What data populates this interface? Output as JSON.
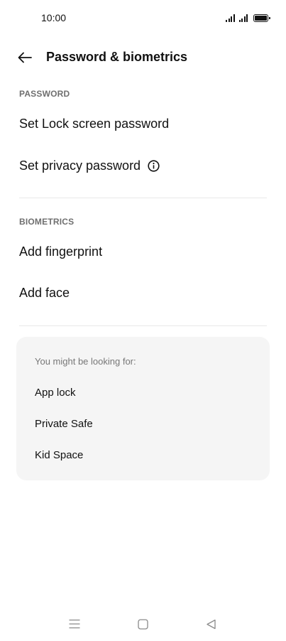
{
  "status_bar": {
    "time": "10:00",
    "icons": [
      "signal-icon",
      "signal-icon",
      "battery-icon"
    ]
  },
  "header": {
    "back_icon": "back-arrow-icon",
    "title": "Password & biometrics"
  },
  "sections": {
    "password": {
      "label": "PASSWORD",
      "items": [
        {
          "label": "Set Lock screen password"
        },
        {
          "label": "Set privacy password",
          "icon": "info-icon"
        }
      ]
    },
    "biometrics": {
      "label": "BIOMETRICS",
      "items": [
        {
          "label": "Add fingerprint"
        },
        {
          "label": "Add face"
        }
      ]
    }
  },
  "suggestions": {
    "heading": "You might be looking for:",
    "items": [
      {
        "label": "App lock"
      },
      {
        "label": "Private Safe"
      },
      {
        "label": "Kid Space"
      }
    ]
  },
  "nav_bar": {
    "icons": [
      "menu-icon",
      "home-icon",
      "back-triangle-icon"
    ]
  },
  "colors": {
    "background": "#ffffff",
    "text": "#111111",
    "section_header": "#6f6f6f",
    "card_background": "#f5f5f5",
    "divider": "#e8e8e8"
  }
}
